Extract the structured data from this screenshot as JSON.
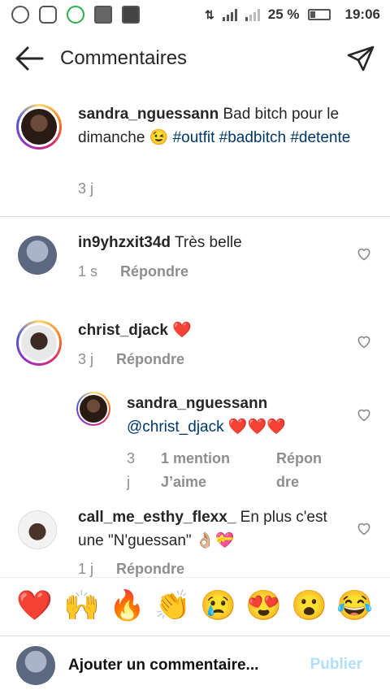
{
  "status_bar": {
    "battery": "25 %",
    "time": "19:06",
    "icons": [
      "b-app-icon",
      "instagram-icon",
      "whatsapp-like-icon",
      "gallery-icon",
      "activity-icon"
    ],
    "network": [
      "data-arrows-icon",
      "H+",
      "H"
    ]
  },
  "header": {
    "title": "Commentaires",
    "back_icon": "arrow-left-icon",
    "send_icon": "paper-plane-icon"
  },
  "caption": {
    "username": "sandra_nguessann",
    "text": " Bad bitch pour le dimanche 😉 ",
    "tags": [
      "#outfit",
      "#badbitch",
      "#detente"
    ],
    "time": "3 j"
  },
  "comments": [
    {
      "username": "in9yhzxit34d",
      "text": " Très belle",
      "time": "1 s",
      "reply": "Répondre"
    },
    {
      "username": "christ_djack",
      "text": " ❤️",
      "time": "3 j",
      "reply": "Répondre"
    },
    {
      "username": "sandra_nguessann",
      "mention": "@christ_djack",
      "text": " ❤️❤️❤️",
      "time_l1": "3",
      "time_l2": "j",
      "likes_l1": "1 mention",
      "likes_l2": "J’aime",
      "reply_l1": "Répon",
      "reply_l2": "dre",
      "is_reply": true
    },
    {
      "username": "call_me_esthy_flexx_",
      "text": " En plus c'est une \"N'guessan\" 👌🏼💝",
      "time": "1 j",
      "reply": "Répondre"
    }
  ],
  "emoji_bar": [
    "❤️",
    "🙌",
    "🔥",
    "👏",
    "😢",
    "😍",
    "😮",
    "😂"
  ],
  "composer": {
    "placeholder": "Ajouter un commentaire...",
    "publish": "Publier"
  },
  "colors": {
    "hashtag": "#00376b",
    "muted": "#8e8e8e",
    "publish_disabled": "#b2dffc"
  }
}
